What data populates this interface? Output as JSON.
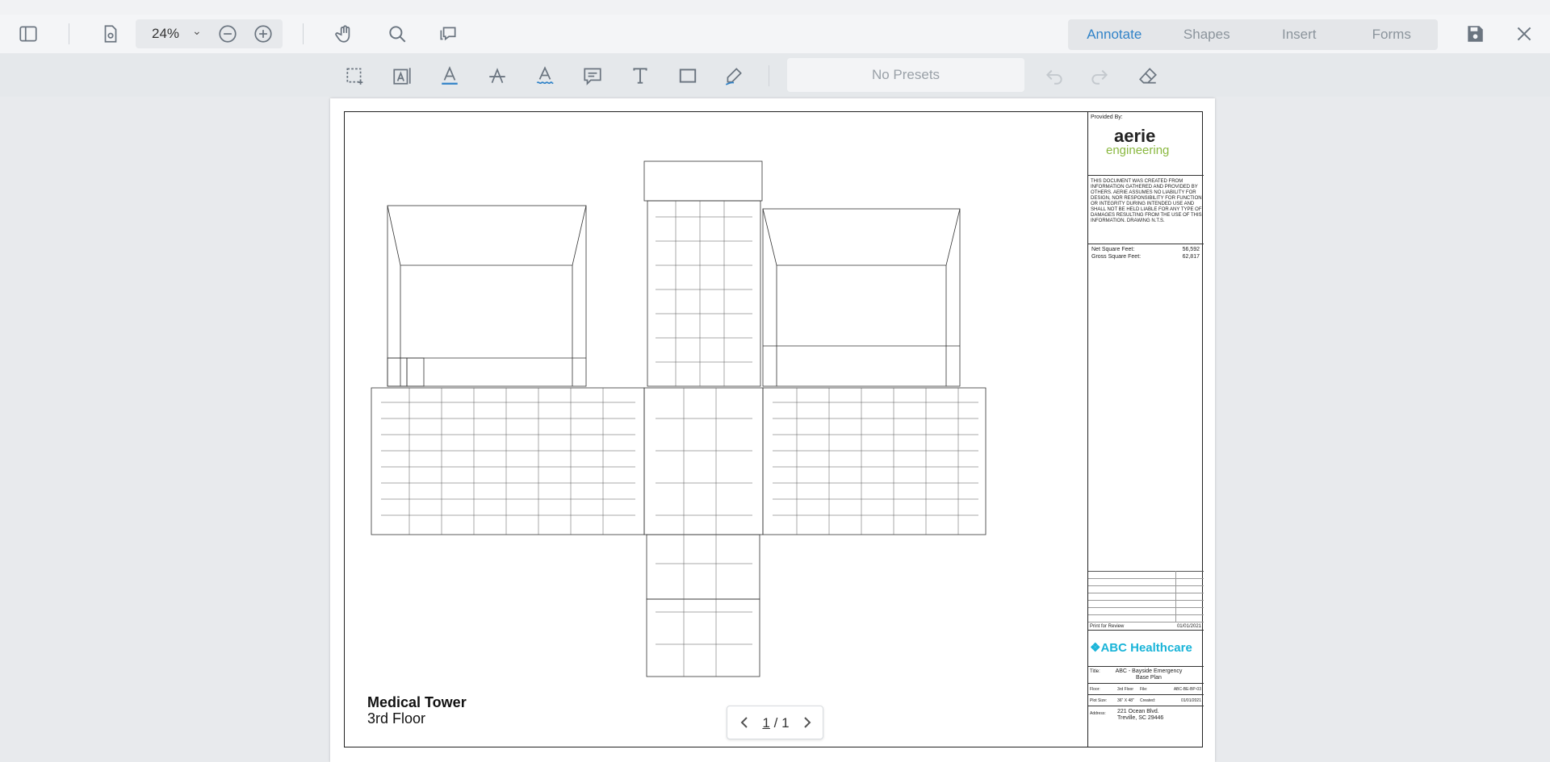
{
  "header": {
    "zoom_value": "24",
    "zoom_unit": "%",
    "tabs": [
      {
        "label": "Annotate",
        "active": true
      },
      {
        "label": "Shapes",
        "active": false
      },
      {
        "label": "Insert",
        "active": false
      },
      {
        "label": "Forms",
        "active": false
      }
    ],
    "icons_left": [
      "sidebar-toggle-icon",
      "page-settings-icon",
      "zoom-out-icon",
      "zoom-in-icon",
      "pan-hand-icon",
      "search-icon",
      "comments-icon"
    ],
    "icons_right": [
      "save-icon",
      "close-icon"
    ]
  },
  "toolbar": {
    "tools": [
      "area-select-icon",
      "text-select-icon",
      "underline-icon",
      "strikeout-icon",
      "squiggly-icon",
      "note-icon",
      "free-text-icon",
      "rectangle-icon",
      "freehand-pen-icon"
    ],
    "presets_label": "No Presets",
    "undo_enabled": false,
    "redo_enabled": false
  },
  "document": {
    "title": "Medical Tower",
    "subtitle": "3rd Floor",
    "title_block": {
      "provided_by": "Provided By:",
      "logo_top": "aerie",
      "logo_bottom": "engineering",
      "disclaimer": "THIS DOCUMENT WAS CREATED FROM INFORMATION GATHERED AND PROVIDED BY OTHERS. AERIE ASSUMES NO LIABILITY FOR DESIGN, NOR RESPONSIBILITY FOR FUNCTION OR INTEGRITY DURING INTENDED USE AND SHALL NOT BE HELD LIABLE FOR ANY TYPE OF DAMAGES RESULTING FROM THE USE OF THIS INFORMATION. DRAWING N.T.S.",
      "net_sf_label": "Net Square Feet:",
      "net_sf_value": "56,592",
      "gross_sf_label": "Gross Square Feet:",
      "gross_sf_value": "62,817",
      "review_label": "Print for Review",
      "review_date": "01/01/2021",
      "client": "ABC Healthcare",
      "title_label": "Title:",
      "title_value_1": "ABC - Bayside Emergency",
      "title_value_2": "Base Plan",
      "floor_label": "Floor:",
      "floor_value": "3rd Floor",
      "file_label": "File:",
      "file_value": "ABC-BE-BP-03",
      "plot_label": "Plot Size:",
      "plot_value": "36\" X 48\"",
      "created_label": "Created:",
      "created_value": "01/01/2021",
      "address_label": "Address:",
      "address_line_1": "221 Ocean Blvd.",
      "address_line_2": "Treville, SC 29446"
    }
  },
  "pager": {
    "current": "1",
    "separator": "/",
    "total": "1"
  },
  "colors": {
    "accent": "#3183c8",
    "logo_green": "#8ab840",
    "client_blue": "#1ab4d8"
  }
}
